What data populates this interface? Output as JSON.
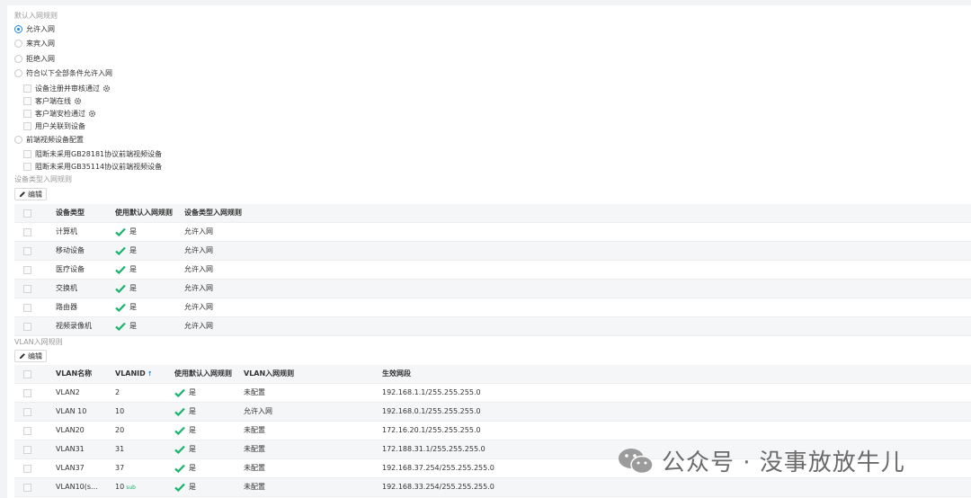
{
  "default_rule": {
    "title": "默认入网规则",
    "options": [
      "允许入网",
      "来宾入网",
      "拒绝入网",
      "符合以下全部条件允许入网"
    ],
    "conditions": [
      "设备注册并审核通过",
      "客户端在线",
      "客户端安检通过",
      "用户关联到设备"
    ],
    "front_option": "前端视频设备配置",
    "front_conditions": [
      "阻断未采用GB28181协议前端视频设备",
      "阻断未采用GB35114协议前端视频设备"
    ]
  },
  "device_section": {
    "title": "设备类型入网规则",
    "edit_label": "编辑",
    "headers": [
      "设备类型",
      "使用默认入网规则",
      "设备类型入网规则"
    ],
    "rows": [
      {
        "type": "计算机",
        "use_default": "是",
        "rule": "允许入网"
      },
      {
        "type": "移动设备",
        "use_default": "是",
        "rule": "允许入网"
      },
      {
        "type": "医疗设备",
        "use_default": "是",
        "rule": "允许入网"
      },
      {
        "type": "交换机",
        "use_default": "是",
        "rule": "允许入网"
      },
      {
        "type": "路由器",
        "use_default": "是",
        "rule": "允许入网"
      },
      {
        "type": "视频录像机",
        "use_default": "是",
        "rule": "允许入网"
      }
    ]
  },
  "vlan_section": {
    "title": "VLAN入网规则",
    "edit_label": "编辑",
    "headers": [
      "VLAN名称",
      "VLANID",
      "使用默认入网规则",
      "VLAN入网规则",
      "生效网段"
    ],
    "sort_icon": "sort-arrow-icon",
    "rows": [
      {
        "name": "VLAN2",
        "id": "2",
        "use_default": "是",
        "rule": "未配置",
        "segment": "192.168.1.1/255.255.255.0"
      },
      {
        "name": "VLAN 10",
        "id": "10",
        "use_default": "是",
        "rule": "允许入网",
        "segment": "192.168.0.1/255.255.255.0"
      },
      {
        "name": "VLAN20",
        "id": "20",
        "use_default": "是",
        "rule": "未配置",
        "segment": "172.16.20.1/255.255.255.0"
      },
      {
        "name": "VLAN31",
        "id": "31",
        "use_default": "是",
        "rule": "未配置",
        "segment": "172.188.31.1/255.255.255.0"
      },
      {
        "name": "VLAN37",
        "id": "37",
        "use_default": "是",
        "rule": "未配置",
        "segment": "192.168.37.254/255.255.255.0"
      },
      {
        "name": "VLAN10(s...",
        "id": "10",
        "id_badge": "sub",
        "use_default": "是",
        "rule": "未配置",
        "segment": "192.168.33.254/255.255.255.0"
      }
    ]
  },
  "watermark": {
    "text": "公众号 · 没事放放牛儿"
  },
  "colors": {
    "accent": "#1e88e5",
    "check": "#19b36b"
  }
}
